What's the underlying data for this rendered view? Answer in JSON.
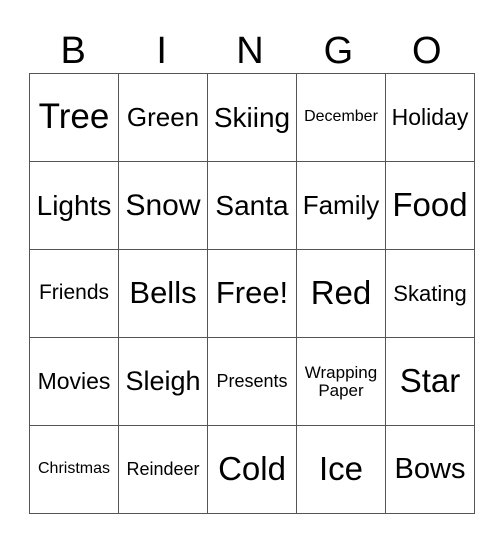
{
  "header": [
    "B",
    "I",
    "N",
    "G",
    "O"
  ],
  "rows": [
    [
      {
        "t": "Tree",
        "s": 35
      },
      {
        "t": "Green",
        "s": 26
      },
      {
        "t": "Skiing",
        "s": 28
      },
      {
        "t": "December",
        "s": 16
      },
      {
        "t": "Holiday",
        "s": 23
      }
    ],
    [
      {
        "t": "Lights",
        "s": 28
      },
      {
        "t": "Snow",
        "s": 30
      },
      {
        "t": "Santa",
        "s": 28
      },
      {
        "t": "Family",
        "s": 26
      },
      {
        "t": "Food",
        "s": 33
      }
    ],
    [
      {
        "t": "Friends",
        "s": 21
      },
      {
        "t": "Bells",
        "s": 31
      },
      {
        "t": "Free!",
        "s": 31
      },
      {
        "t": "Red",
        "s": 33
      },
      {
        "t": "Skating",
        "s": 22
      }
    ],
    [
      {
        "t": "Movies",
        "s": 23
      },
      {
        "t": "Sleigh",
        "s": 27
      },
      {
        "t": "Presents",
        "s": 18
      },
      {
        "t": "Wrapping Paper",
        "s": 17
      },
      {
        "t": "Star",
        "s": 33
      }
    ],
    [
      {
        "t": "Christmas",
        "s": 16
      },
      {
        "t": "Reindeer",
        "s": 18
      },
      {
        "t": "Cold",
        "s": 33
      },
      {
        "t": "Ice",
        "s": 33
      },
      {
        "t": "Bows",
        "s": 29
      }
    ]
  ]
}
